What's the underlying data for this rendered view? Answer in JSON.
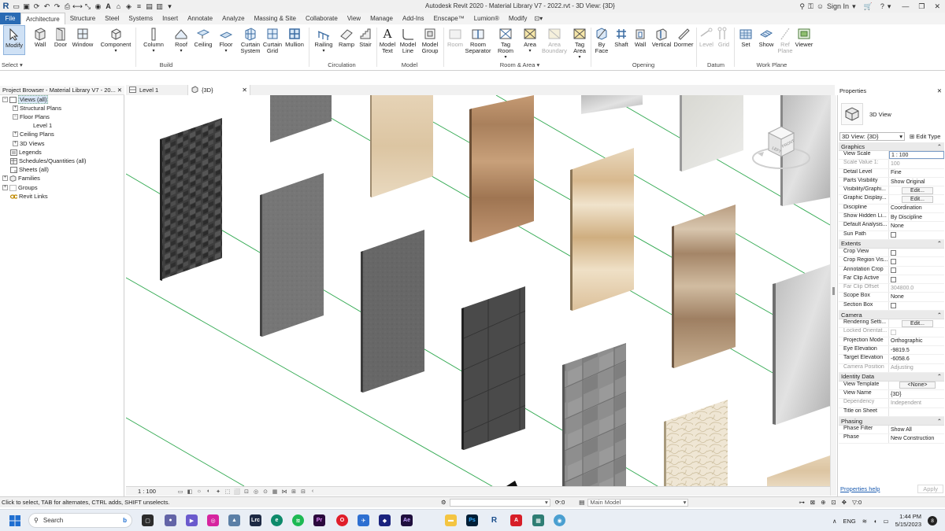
{
  "window": {
    "title": "Autodesk Revit 2020 - Material Library V7 - 2022.rvt - 3D View: {3D}",
    "sign_in": "Sign In"
  },
  "ribbon_tabs": [
    "File",
    "Architecture",
    "Structure",
    "Steel",
    "Systems",
    "Insert",
    "Annotate",
    "Analyze",
    "Massing & Site",
    "Collaborate",
    "View",
    "Manage",
    "Add-Ins",
    "Enscape™",
    "Lumion®",
    "Modify"
  ],
  "ribbon": {
    "buttons": [
      {
        "label": "Modify",
        "icon": "cursor-icon"
      },
      {
        "label": "Wall",
        "icon": "wall-icon"
      },
      {
        "label": "Door",
        "icon": "door-icon"
      },
      {
        "label": "Window",
        "icon": "window-icon"
      },
      {
        "label": "Component",
        "icon": "component-icon"
      },
      {
        "label": "Column",
        "icon": "column-icon"
      },
      {
        "label": "Roof",
        "icon": "roof-icon"
      },
      {
        "label": "Ceiling",
        "icon": "ceiling-icon"
      },
      {
        "label": "Floor",
        "icon": "floor-icon"
      },
      {
        "label": "Curtain\nSystem",
        "icon": "curtain-system-icon"
      },
      {
        "label": "Curtain\nGrid",
        "icon": "curtain-grid-icon"
      },
      {
        "label": "Mullion",
        "icon": "mullion-icon"
      },
      {
        "label": "Railing",
        "icon": "railing-icon"
      },
      {
        "label": "Ramp",
        "icon": "ramp-icon"
      },
      {
        "label": "Stair",
        "icon": "stair-icon"
      },
      {
        "label": "Model\nText",
        "icon": "model-text-icon"
      },
      {
        "label": "Model\nLine",
        "icon": "model-line-icon"
      },
      {
        "label": "Model\nGroup",
        "icon": "model-group-icon"
      },
      {
        "label": "Room",
        "icon": "room-icon"
      },
      {
        "label": "Room\nSeparator",
        "icon": "room-separator-icon"
      },
      {
        "label": "Tag\nRoom",
        "icon": "tag-room-icon"
      },
      {
        "label": "Area",
        "icon": "area-icon"
      },
      {
        "label": "Area\nBoundary",
        "icon": "area-boundary-icon"
      },
      {
        "label": "Tag\nArea",
        "icon": "tag-area-icon"
      },
      {
        "label": "By\nFace",
        "icon": "by-face-icon"
      },
      {
        "label": "Shaft",
        "icon": "shaft-icon"
      },
      {
        "label": "Wall",
        "icon": "wall-opening-icon"
      },
      {
        "label": "Vertical",
        "icon": "vertical-icon"
      },
      {
        "label": "Dormer",
        "icon": "dormer-icon"
      },
      {
        "label": "Level",
        "icon": "level-icon"
      },
      {
        "label": "Grid",
        "icon": "grid-icon"
      },
      {
        "label": "Set",
        "icon": "set-workplane-icon"
      },
      {
        "label": "Show",
        "icon": "show-workplane-icon"
      },
      {
        "label": "Ref\nPlane",
        "icon": "ref-plane-icon"
      },
      {
        "label": "Viewer",
        "icon": "viewer-icon"
      }
    ],
    "groups": [
      "Select",
      "Build",
      "Circulation",
      "Model",
      "Room & Area",
      "Opening",
      "Datum",
      "Work Plane"
    ]
  },
  "project_browser": {
    "title": "Project Browser - Material Library V7 - 20...",
    "items": [
      {
        "label": "Views (all)",
        "level": 0
      },
      {
        "label": "Structural Plans",
        "level": 1
      },
      {
        "label": "Floor Plans",
        "level": 1
      },
      {
        "label": "Level 1",
        "level": 2
      },
      {
        "label": "Ceiling Plans",
        "level": 1
      },
      {
        "label": "3D Views",
        "level": 1
      },
      {
        "label": "Legends",
        "level": 0
      },
      {
        "label": "Schedules/Quantities (all)",
        "level": 0
      },
      {
        "label": "Sheets (all)",
        "level": 0
      },
      {
        "label": "Families",
        "level": 0
      },
      {
        "label": "Groups",
        "level": 0
      },
      {
        "label": "Revit Links",
        "level": 0
      }
    ]
  },
  "view_tabs": [
    "Level 1",
    "{3D}"
  ],
  "viewcube": {
    "left": "LEFT",
    "front": "FRONT"
  },
  "view_control": {
    "scale": "1 : 100"
  },
  "properties": {
    "title": "Properties",
    "type_name": "3D View",
    "selector": "3D View: {3D}",
    "edit_type": "Edit Type",
    "groups": [
      {
        "name": "Graphics",
        "rows": [
          {
            "k": "View Scale",
            "v": "1 : 100",
            "kind": "input"
          },
          {
            "k": "Scale Value    1:",
            "v": "100",
            "kind": "dim"
          },
          {
            "k": "Detail Level",
            "v": "Fine"
          },
          {
            "k": "Parts Visibility",
            "v": "Show Original"
          },
          {
            "k": "Visibility/Graphi...",
            "v": "Edit...",
            "kind": "btn"
          },
          {
            "k": "Graphic Display...",
            "v": "Edit...",
            "kind": "btn"
          },
          {
            "k": "Discipline",
            "v": "Coordination"
          },
          {
            "k": "Show Hidden Li...",
            "v": "By Discipline"
          },
          {
            "k": "Default Analysis...",
            "v": "None"
          },
          {
            "k": "Sun Path",
            "v": "",
            "kind": "cb"
          }
        ]
      },
      {
        "name": "Extents",
        "rows": [
          {
            "k": "Crop View",
            "v": "",
            "kind": "cb"
          },
          {
            "k": "Crop Region Vis...",
            "v": "",
            "kind": "cb"
          },
          {
            "k": "Annotation Crop",
            "v": "",
            "kind": "cb"
          },
          {
            "k": "Far Clip Active",
            "v": "",
            "kind": "cb"
          },
          {
            "k": "Far Clip Offset",
            "v": "304800.0",
            "kind": "dim"
          },
          {
            "k": "Scope Box",
            "v": "None"
          },
          {
            "k": "Section Box",
            "v": "",
            "kind": "cb"
          }
        ]
      },
      {
        "name": "Camera",
        "rows": [
          {
            "k": "Rendering Setti...",
            "v": "Edit...",
            "kind": "btn"
          },
          {
            "k": "Locked Orientat...",
            "v": "",
            "kind": "dimcb"
          },
          {
            "k": "Projection Mode",
            "v": "Orthographic"
          },
          {
            "k": "Eye Elevation",
            "v": "-9819.5"
          },
          {
            "k": "Target Elevation",
            "v": "-6058.6"
          },
          {
            "k": "Camera Position",
            "v": "Adjusting",
            "kind": "dim"
          }
        ]
      },
      {
        "name": "Identity Data",
        "rows": [
          {
            "k": "View Template",
            "v": "<None>",
            "kind": "btn"
          },
          {
            "k": "View Name",
            "v": "{3D}"
          },
          {
            "k": "Dependency",
            "v": "Independent",
            "kind": "dim"
          },
          {
            "k": "Title on Sheet",
            "v": ""
          }
        ]
      },
      {
        "name": "Phasing",
        "rows": [
          {
            "k": "Phase Filter",
            "v": "Show All"
          },
          {
            "k": "Phase",
            "v": "New Construction"
          }
        ]
      }
    ],
    "help": "Properties help",
    "apply": "Apply"
  },
  "status": {
    "message": "Click to select, TAB for alternates, CTRL adds, SHIFT unselects.",
    "workset_value": ":0",
    "model": "Main Model",
    "filter_value": ":0"
  },
  "taskbar": {
    "search_placeholder": "Search",
    "lang": "ENG",
    "time": "1:44 PM",
    "date": "5/15/2023",
    "notifications": "8"
  },
  "colors": {
    "accent": "#2a6bb4",
    "grid_line": "#2fa84f"
  }
}
